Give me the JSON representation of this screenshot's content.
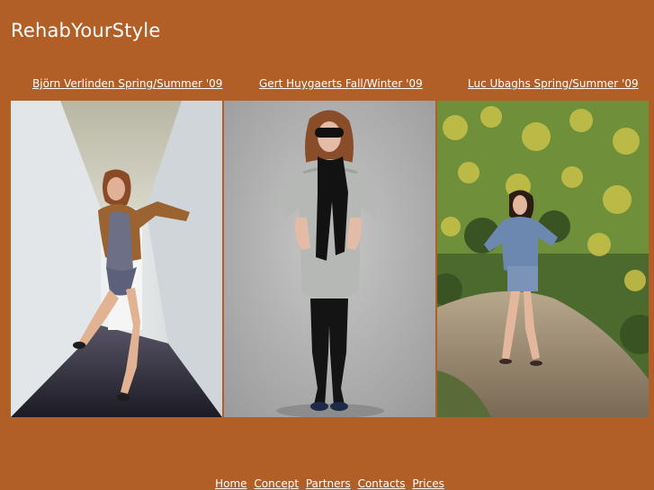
{
  "site": {
    "title": "RehabYourStyle"
  },
  "collections": [
    {
      "label": "Björn Verlinden Spring/Summer '09"
    },
    {
      "label": "Gert Huygaerts Fall/Winter '09"
    },
    {
      "label": "Luc Ubaghs Spring/Summer '09"
    }
  ],
  "footer": {
    "links": [
      "Home",
      "Concept",
      "Partners",
      "Contacts",
      "Prices"
    ]
  },
  "colors": {
    "background": "#b15f27",
    "text": "#ffffff"
  }
}
